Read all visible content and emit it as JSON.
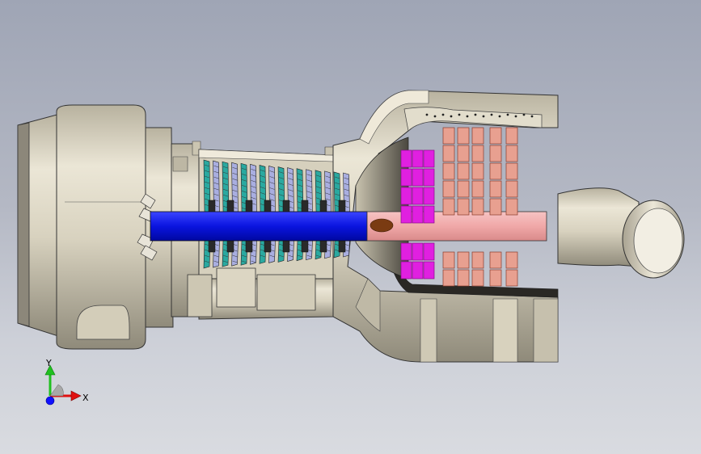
{
  "scene": {
    "background_top": "#9fa5b5",
    "background_bottom": "#d9dbe0",
    "shell_color": "#d8d2bf",
    "shaft_color": "#0a14e0",
    "compressor_blade_colors": [
      "#2aa9a0",
      "#a9aee0"
    ],
    "combustor_blade_color": "#e020e0",
    "turbine_blade_color": "#e8a090",
    "turbine_shaft_color": "#f0a8a8",
    "fuel_nozzle_color": "#7a3b12"
  },
  "triad": {
    "y_label": "Y",
    "x_label": "X",
    "z_marker_color": "#1010ff",
    "y_color": "#20c020",
    "x_color": "#e01010"
  }
}
